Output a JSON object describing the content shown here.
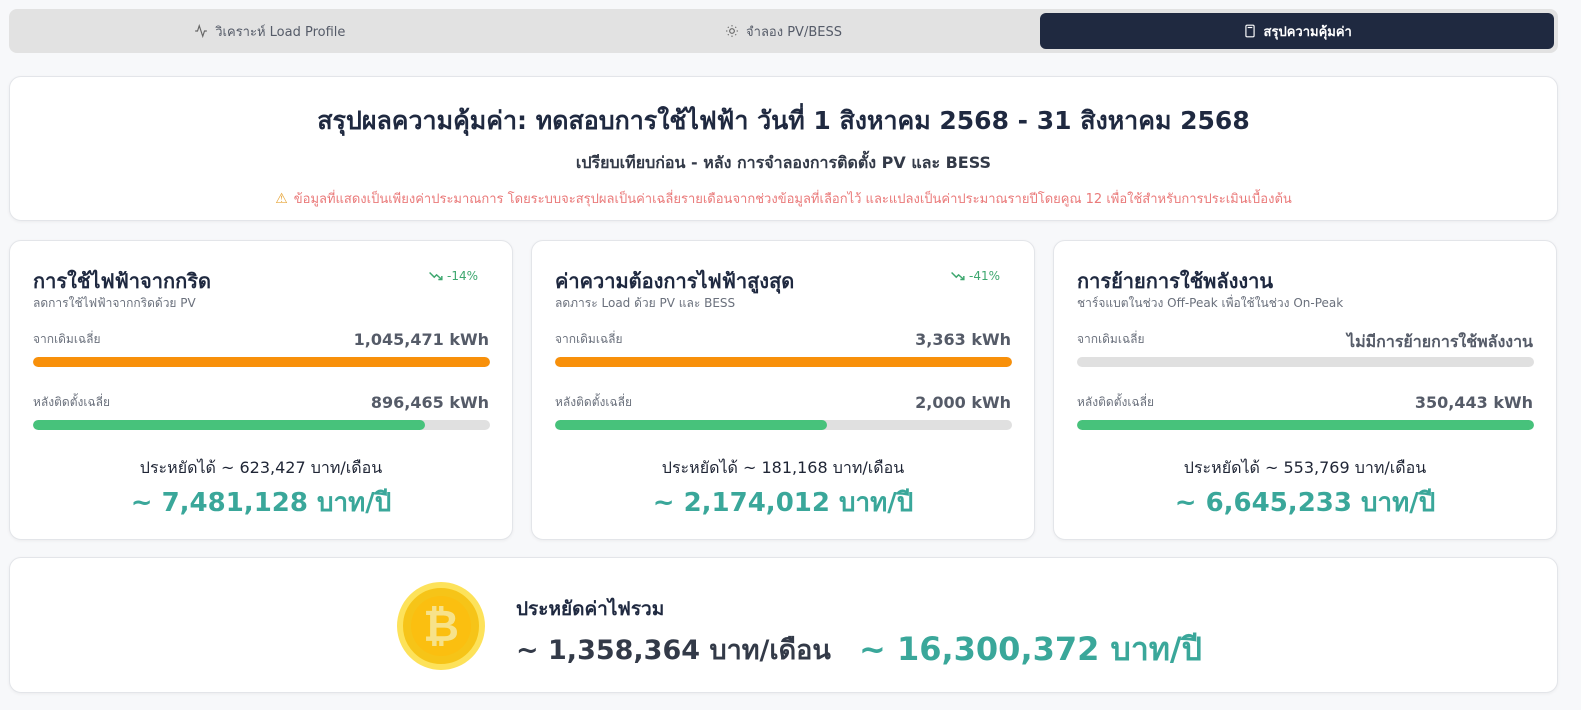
{
  "tabs": [
    {
      "label": "วิเคราะห์ Load Profile",
      "icon": "activity-icon"
    },
    {
      "label": "จำลอง PV/BESS",
      "icon": "sun-icon"
    },
    {
      "label": "สรุปความคุ้มค่า",
      "icon": "calculator-icon"
    }
  ],
  "header": {
    "title": "สรุปผลความคุ้มค่า: ทดสอบการใช้ไฟฟ้า วันที่ 1 สิงหาคม 2568 - 31 สิงหาคม 2568",
    "subtitle": "เปรียบเทียบก่อน - หลัง การจำลองการติดตั้ง PV และ BESS",
    "warning": "ข้อมูลที่แสดงเป็นเพียงค่าประมาณการ โดยระบบจะสรุปผลเป็นค่าเฉลี่ยรายเดือนจากช่วงข้อมูลที่เลือกไว้ และแปลงเป็นค่าประมาณรายปีโดยคูณ 12 เพื่อใช้สำหรับการประเมินเบื้องต้น"
  },
  "metrics": [
    {
      "title": "การใช้ไฟฟ้าจากกริด",
      "desc": "ลดการใช้ไฟฟ้าจากกริดด้วย PV",
      "trend": "-14%",
      "before_label": "จากเดิมเฉลี่ย",
      "before_value": "1,045,471 kWh",
      "before_fill": 1.0,
      "after_label": "หลังติดตั้งเฉลี่ย",
      "after_value": "896,465 kWh",
      "after_fill": 0.857,
      "save_month": "ประหยัดได้ ~ 623,427 บาท/เดือน",
      "save_year": "~ 7,481,128 บาท/ปี"
    },
    {
      "title": "ค่าความต้องการไฟฟ้าสูงสุด",
      "desc": "ลดภาระ Load ด้วย PV และ BESS",
      "trend": "-41%",
      "before_label": "จากเดิมเฉลี่ย",
      "before_value": "3,363 kWh",
      "before_fill": 1.0,
      "after_label": "หลังติดตั้งเฉลี่ย",
      "after_value": "2,000 kWh",
      "after_fill": 0.595,
      "save_month": "ประหยัดได้ ~ 181,168 บาท/เดือน",
      "save_year": "~ 2,174,012 บาท/ปี"
    },
    {
      "title": "การย้ายการใช้พลังงาน",
      "desc": "ชาร์จแบตในช่วง Off-Peak เพื่อใช้ในช่วง On-Peak",
      "trend": "",
      "before_label": "จากเดิมเฉลี่ย",
      "before_value": "ไม่มีการย้ายการใช้พลังงาน",
      "before_fill": 0.0,
      "after_label": "หลังติดตั้งเฉลี่ย",
      "after_value": "350,443 kWh",
      "after_fill": 1.0,
      "save_month": "ประหยัดได้ ~ 553,769 บาท/เดือน",
      "save_year": "~ 6,645,233 บาท/ปี"
    }
  ],
  "total": {
    "title": "ประหยัดค่าไฟรวม",
    "month": "~ 1,358,364 บาท/เดือน",
    "year": "~ 16,300,372 บาท/ปี",
    "icon": "bitcoin-coin-icon"
  },
  "colors": {
    "accent_dark": "#1f2940",
    "before_bar": "#f8900a",
    "after_bar": "#47c27b",
    "savings": "#3aa79a",
    "warning_text": "#ea7a7a"
  }
}
